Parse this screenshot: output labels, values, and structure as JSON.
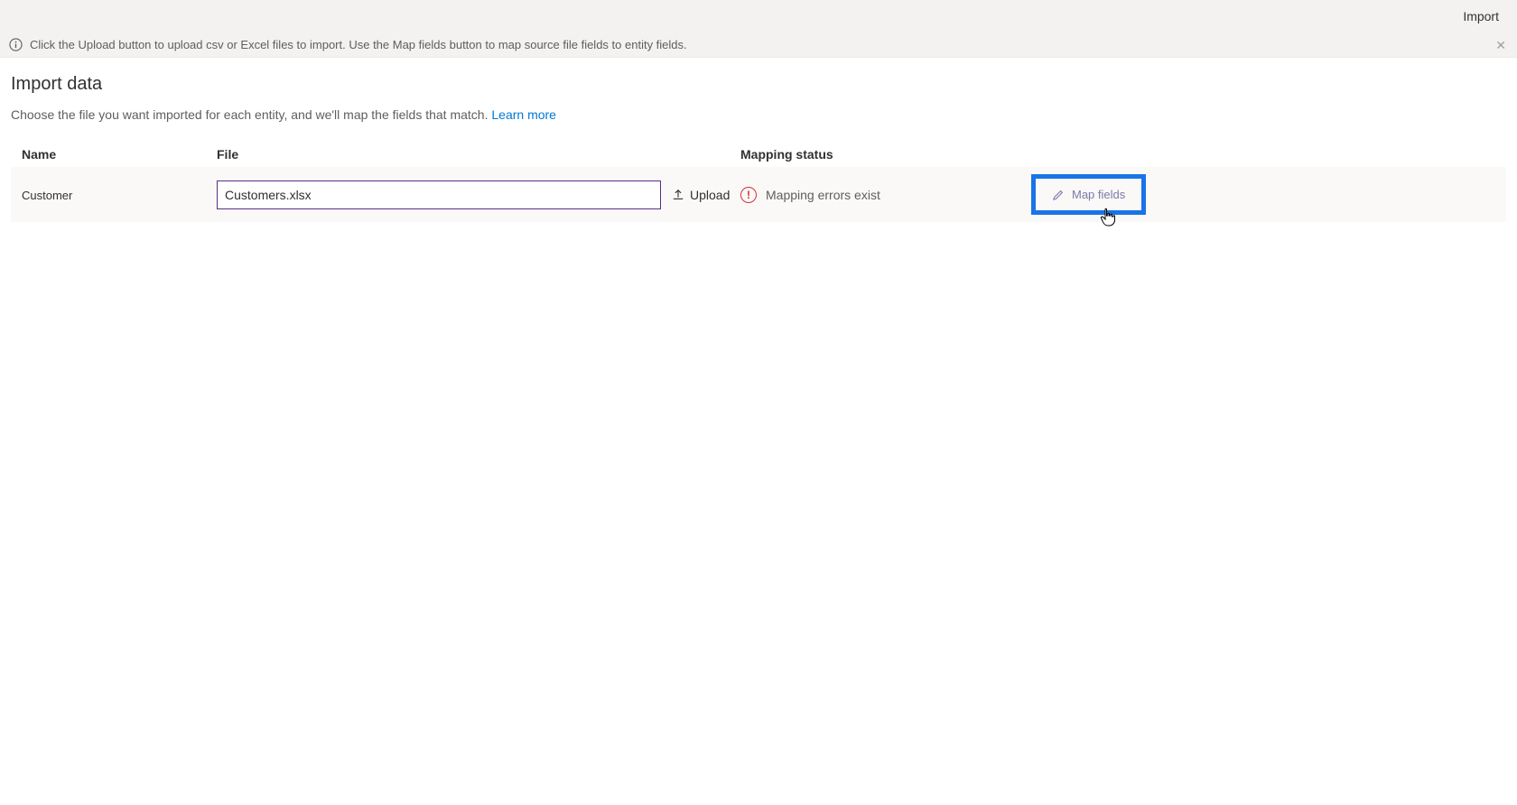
{
  "header": {
    "import_label": "Import"
  },
  "info_banner": {
    "text": "Click the Upload button to upload csv or Excel files to import. Use the Map fields button to map source file fields to entity fields."
  },
  "page": {
    "title": "Import data",
    "description": "Choose the file you want imported for each entity, and we'll map the fields that match. ",
    "learn_more": "Learn more"
  },
  "columns": {
    "name": "Name",
    "file": "File",
    "status": "Mapping status"
  },
  "entities": [
    {
      "name": "Customer",
      "file_value": "Customers.xlsx",
      "upload_label": "Upload",
      "status_text": "Mapping errors exist",
      "map_fields_label": "Map fields"
    }
  ]
}
